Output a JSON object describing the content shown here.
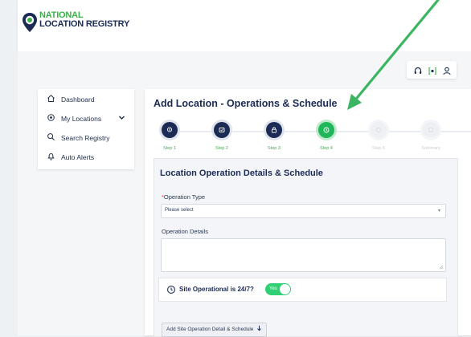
{
  "brand": {
    "line1": "NATIONAL",
    "line2": "LOCATION REGISTRY"
  },
  "colors": {
    "navy": "#1b2b55",
    "green": "#3bb04a",
    "active_step": "#1fb759",
    "toggle_on": "#2fcf74"
  },
  "header_icons": [
    "headset-icon",
    "share-icon",
    "user-icon"
  ],
  "sidebar": {
    "items": [
      {
        "label": "Dashboard",
        "icon": "home-icon"
      },
      {
        "label": "My Locations",
        "icon": "location-icon",
        "expandable": true
      },
      {
        "label": "Search Registry",
        "icon": "search-icon"
      },
      {
        "label": "Auto Alerts",
        "icon": "bell-icon"
      }
    ]
  },
  "page": {
    "title": "Add Location - Operations & Schedule"
  },
  "stepper": {
    "steps": [
      {
        "label": "Step 1",
        "state": "done"
      },
      {
        "label": "Step 2",
        "state": "done"
      },
      {
        "label": "Step 3",
        "state": "done"
      },
      {
        "label": "Step 4",
        "state": "active"
      },
      {
        "label": "Step 5",
        "state": "pending"
      },
      {
        "label": "Summary",
        "state": "pending"
      }
    ]
  },
  "form": {
    "section_title": "Location Operation Details & Schedule",
    "operation_type": {
      "label": "Operation Type",
      "required_mark": "*",
      "value": "Please select"
    },
    "operation_details": {
      "label": "Operation Details",
      "value": ""
    },
    "site_operational": {
      "label": "Site Operational is 24/7?",
      "toggle_text": "Yes",
      "on": true
    },
    "add_button": "Add Site Operation Detail & Schedule"
  }
}
